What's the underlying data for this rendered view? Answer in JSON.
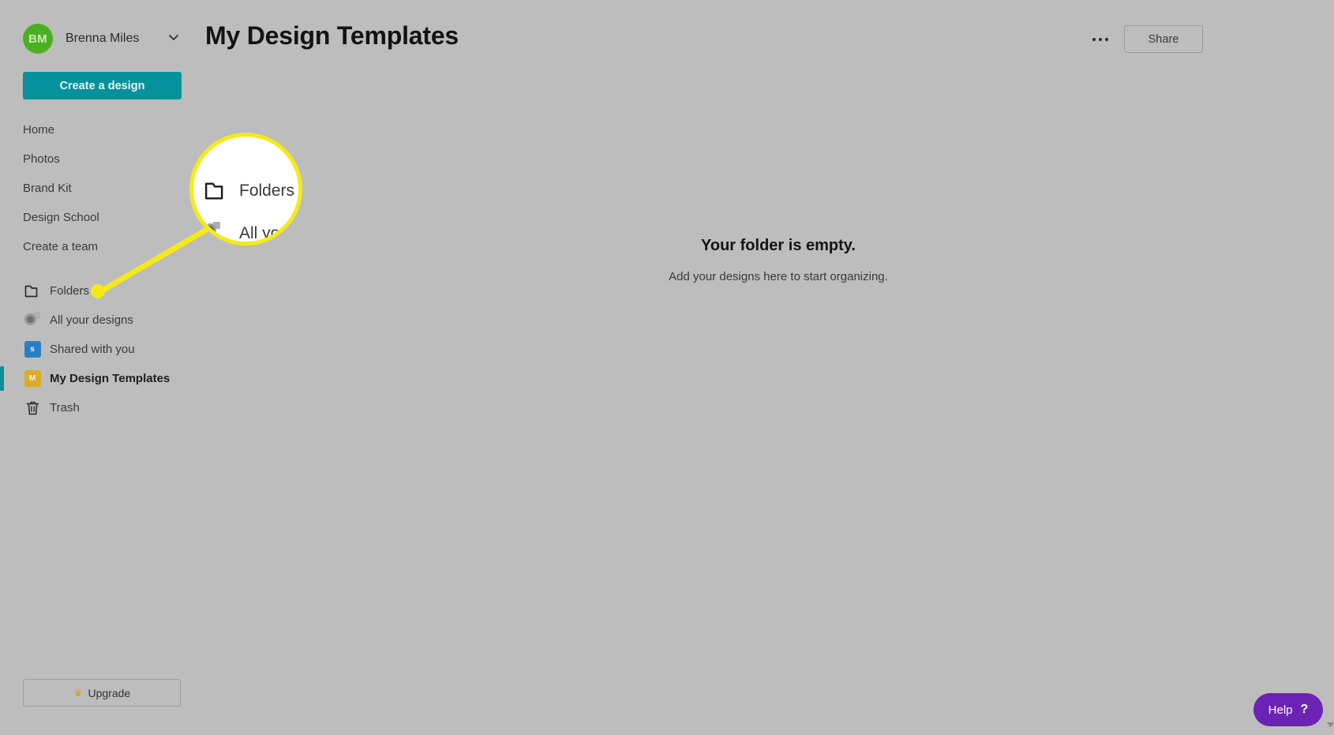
{
  "window": {
    "background_color": "#bdbdbd"
  },
  "sidebar": {
    "account": {
      "initials": "BM",
      "name": "Brenna Miles",
      "avatar_color": "#4caf21",
      "chevron_icon": "chevron-down-icon"
    },
    "create_button": {
      "label": "Create a design",
      "color": "#06929c"
    },
    "nav_top": [
      {
        "label": "Home"
      },
      {
        "label": "Photos"
      },
      {
        "label": "Brand Kit"
      },
      {
        "label": "Design School"
      },
      {
        "label": "Create a team"
      }
    ],
    "nav_bottom": [
      {
        "label": "Folders",
        "icon": "folder-icon",
        "active": false
      },
      {
        "label": "All your designs",
        "icon": "all-designs-icon",
        "active": false
      },
      {
        "label": "Shared with you",
        "icon": "shared-folder-icon",
        "badge": "s",
        "badge_color": "#2a7fc4",
        "active": false
      },
      {
        "label": "My Design Templates",
        "icon": "templates-folder-icon",
        "badge": "M",
        "badge_color": "#ddab24",
        "active": true
      },
      {
        "label": "Trash",
        "icon": "trash-icon",
        "active": false
      }
    ],
    "active_indicator_color": "#0b8f99",
    "upgrade_button": {
      "label": "Upgrade",
      "icon": "crown-icon",
      "icon_color": "#d5a017"
    }
  },
  "header": {
    "title": "My Design Templates",
    "more_button": {
      "icon": "ellipsis-icon",
      "label": ""
    },
    "share_button": {
      "label": "Share"
    }
  },
  "main": {
    "empty_state": {
      "title": "Your folder is empty.",
      "subtitle": "Add your designs here to start organizing."
    }
  },
  "callout": {
    "highlight_color": "#f5ea17",
    "magnified_items": [
      {
        "label": "Folders",
        "icon": "folder-icon"
      },
      {
        "label": "All yo",
        "icon": "all-designs-icon"
      }
    ]
  },
  "help": {
    "label": "Help",
    "question_mark": "?",
    "color": "#6b23b6"
  }
}
